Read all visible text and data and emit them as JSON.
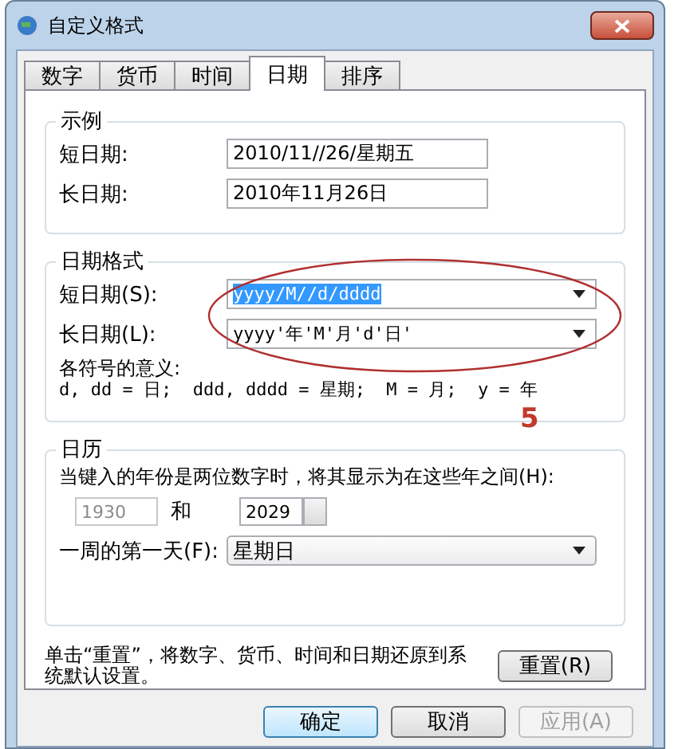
{
  "window": {
    "title": "自定义格式"
  },
  "tabs": [
    {
      "label": "数字",
      "selected": false
    },
    {
      "label": "货币",
      "selected": false
    },
    {
      "label": "时间",
      "selected": false
    },
    {
      "label": "日期",
      "selected": true
    },
    {
      "label": "排序",
      "selected": false
    }
  ],
  "example": {
    "title": "示例",
    "rows": [
      {
        "label": "短日期:",
        "value": "2010/11//26/星期五"
      },
      {
        "label": "长日期:",
        "value": "2010年11月26日"
      }
    ]
  },
  "date_format": {
    "title": "日期格式",
    "rows": [
      {
        "label": "短日期(S):",
        "value": "yyyy/M//d/dddd",
        "selected": true
      },
      {
        "label": "长日期(L):",
        "value": "yyyy'年'M'月'd'日'",
        "selected": false
      }
    ],
    "meaning_title": "各符号的意义:",
    "meaning": "d, dd = 日;  ddd, dddd = 星期;  M = 月;  y = 年",
    "annotation_step": "5"
  },
  "calendar": {
    "title": "日历",
    "two_digit_label": "当键入的年份是两位数字时，将其显示为在这些年之间(H):",
    "from_year": {
      "value": "1930",
      "disabled": true
    },
    "and": "和",
    "to_year": {
      "value": "2029",
      "disabled": false
    },
    "first_day_label": "一周的第一天(F):",
    "first_day": "星期日"
  },
  "reset": {
    "text": "单击“重置”，将数字、货币、时间和日期还原到系统默认设置。",
    "button": "重置(R)"
  },
  "buttons": [
    {
      "label": "确定",
      "disabled": false,
      "default": true
    },
    {
      "label": "取消",
      "disabled": false,
      "default": false
    },
    {
      "label": "应用(A)",
      "disabled": true,
      "default": false
    }
  ]
}
